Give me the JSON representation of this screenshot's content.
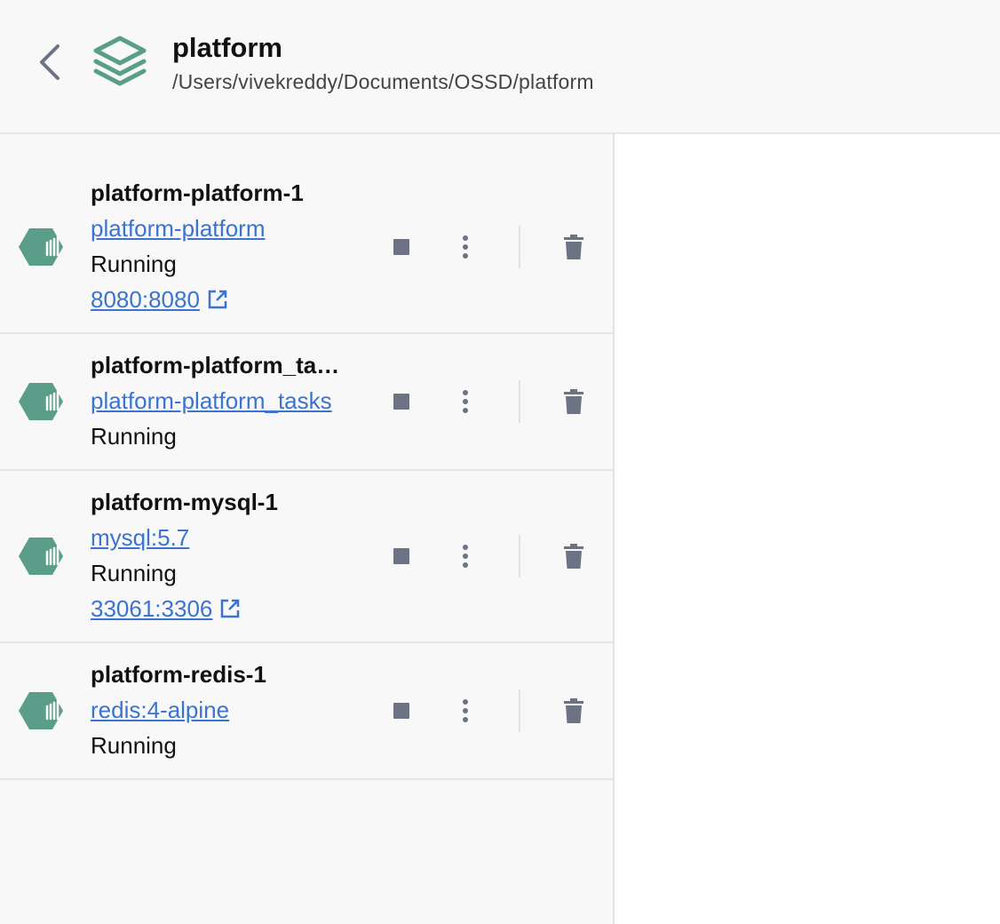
{
  "header": {
    "title": "platform",
    "path": "/Users/vivekreddy/Documents/OSSD/platform"
  },
  "containers": [
    {
      "name": "platform-platform-1",
      "image": "platform-platform",
      "status": "Running",
      "port": "8080:8080"
    },
    {
      "name": "platform-platform_ta…",
      "image": "platform-platform_tasks",
      "status": "Running"
    },
    {
      "name": "platform-mysql-1",
      "image": "mysql:5.7",
      "status": "Running",
      "port": "33061:3306"
    },
    {
      "name": "platform-redis-1",
      "image": "redis:4-alpine",
      "status": "Running"
    }
  ],
  "icons": {
    "back": "chevron-left-icon",
    "project": "stack-layers-icon",
    "container": "container-icon",
    "stop": "stop-icon",
    "more": "more-vertical-icon",
    "delete": "trash-icon",
    "external": "external-link-icon"
  },
  "colors": {
    "accent_green": "#5a9e8a",
    "link_blue": "#3b74d0",
    "icon_gray": "#6b7385"
  }
}
